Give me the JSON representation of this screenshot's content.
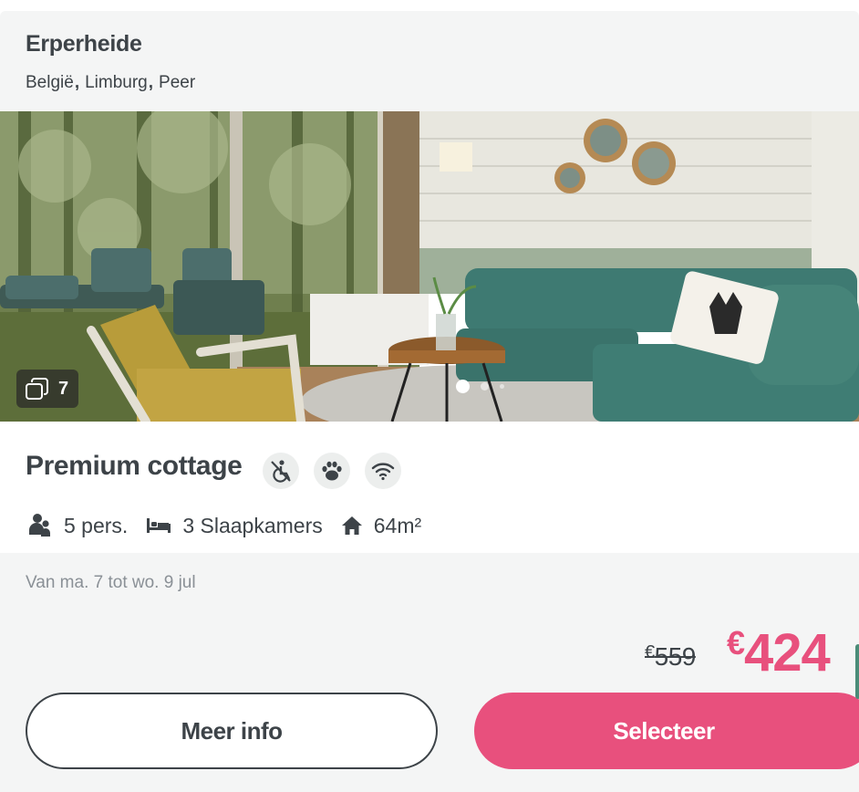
{
  "header": {
    "title": "Erperheide",
    "location": [
      "België",
      "Limburg",
      "Peer"
    ],
    "separator": ","
  },
  "gallery": {
    "photo_count": "7",
    "photo_description_icon": "gallery-icon",
    "dots": 3,
    "active_dot": 0
  },
  "accommodation": {
    "name": "Premium cottage",
    "features": [
      {
        "icon": "no-wheelchair-icon"
      },
      {
        "icon": "paw-icon"
      },
      {
        "icon": "wifi-icon"
      }
    ],
    "persons": "5 pers.",
    "bedrooms": "3 Slaapkamers",
    "area": "64m²"
  },
  "booking": {
    "dates": "Van ma. 7 tot wo. 9 jul",
    "currency": "€",
    "old_price": "559",
    "new_price": "424",
    "more_info_label": "Meer info",
    "select_label": "Selecteer"
  },
  "colors": {
    "accent": "#e8507d",
    "text": "#3d4348",
    "panel": "#f4f5f5"
  }
}
